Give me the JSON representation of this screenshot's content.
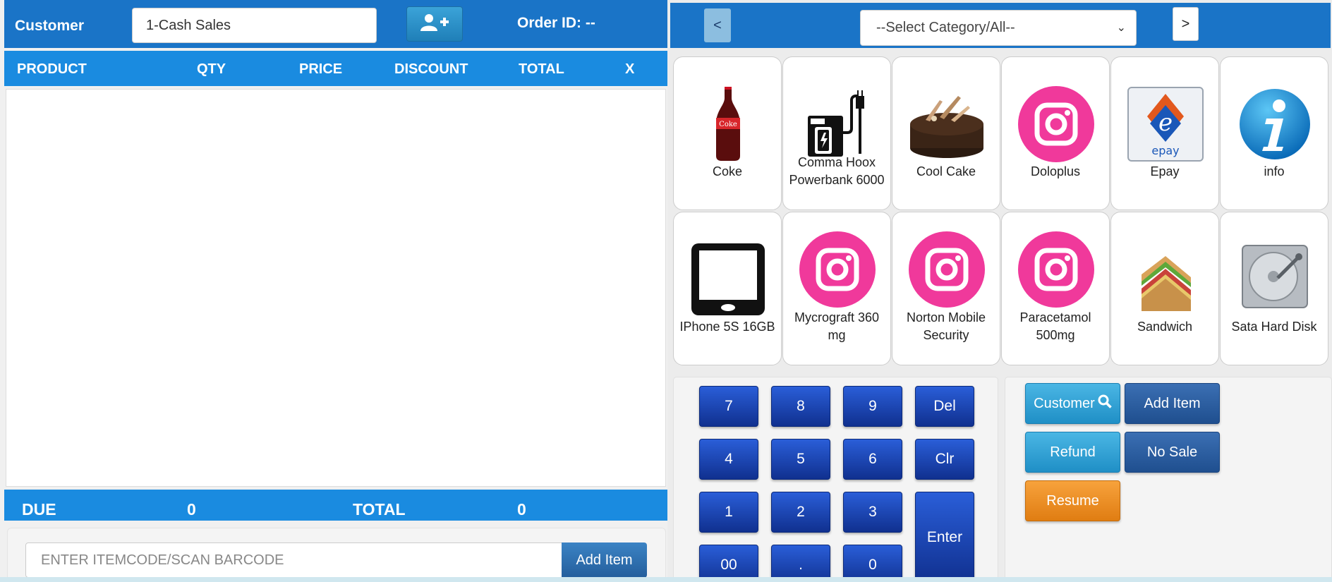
{
  "customer_bar": {
    "label": "Customer",
    "customer_value": "1-Cash Sales",
    "order_id": "Order ID: --"
  },
  "cart_table": {
    "columns": [
      "PRODUCT",
      "QTY",
      "PRICE",
      "DISCOUNT",
      "TOTAL",
      "X"
    ]
  },
  "totals": {
    "due_label": "DUE",
    "due_value": "0",
    "total_label": "TOTAL",
    "total_value": "0"
  },
  "barcode": {
    "placeholder": "ENTER ITEMCODE/SCAN BARCODE",
    "add_item_label": "Add Item"
  },
  "category_bar": {
    "prev_label": "<",
    "next_label": ">",
    "selected": "--Select Category/All--"
  },
  "products": [
    {
      "name": "Coke",
      "icon": "coke-bottle-icon"
    },
    {
      "name": "Comma Hoox Powerbank 6000",
      "icon": "powerbank-icon"
    },
    {
      "name": "Cool Cake",
      "icon": "cake-icon"
    },
    {
      "name": "Doloplus",
      "icon": "instagram-icon"
    },
    {
      "name": "Epay",
      "icon": "epay-logo-icon"
    },
    {
      "name": "info",
      "icon": "info-icon"
    },
    {
      "name": "IPhone 5S 16GB",
      "icon": "phone-icon"
    },
    {
      "name": "Mycrograft 360 mg",
      "icon": "instagram-icon"
    },
    {
      "name": "Norton Mobile Security",
      "icon": "instagram-icon"
    },
    {
      "name": "Paracetamol 500mg",
      "icon": "instagram-icon"
    },
    {
      "name": "Sandwich",
      "icon": "sandwich-icon"
    },
    {
      "name": "Sata Hard Disk",
      "icon": "hard-disk-icon"
    }
  ],
  "epay_text": "epay",
  "numpad": {
    "keys": [
      "7",
      "8",
      "9",
      "Del",
      "4",
      "5",
      "6",
      "Clr",
      "1",
      "2",
      "3",
      "Enter",
      "00",
      ".",
      "0"
    ]
  },
  "actions": {
    "customer": "Customer",
    "add_item": "Add Item",
    "refund": "Refund",
    "no_sale": "No Sale",
    "resume": "Resume"
  },
  "colors": {
    "header_blue": "#1a74c7",
    "table_blue": "#1a8be0",
    "numpad_blue": "#1f47b8",
    "action_cyan": "#2a9fd4",
    "action_navy": "#2a5c9f",
    "action_orange": "#ec8c1f",
    "instagram_pink": "#f0399b"
  }
}
